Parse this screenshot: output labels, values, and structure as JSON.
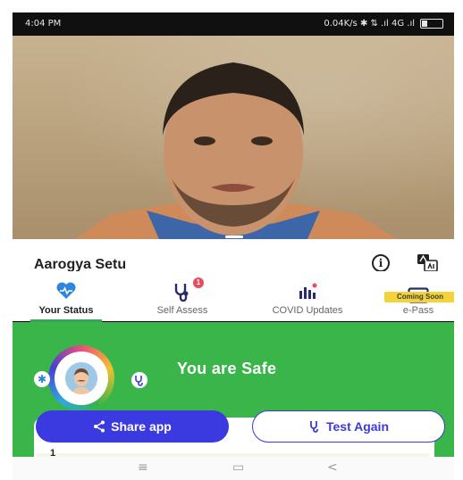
{
  "status_bar": {
    "time": "4:04 PM",
    "network": "0.04K/s ✱ ⇅ .ıl 4G .ıl"
  },
  "app": {
    "title": "Aarogya Setu"
  },
  "tabs": [
    {
      "label": "Your Status",
      "icon": "heart-icon"
    },
    {
      "label": "Self Assess",
      "icon": "stethoscope-icon",
      "badge": "1"
    },
    {
      "label": "COVID Updates",
      "icon": "chart-icon"
    },
    {
      "label": "e-Pass",
      "icon": "pass-icon",
      "tag": "Coming Soon"
    }
  ],
  "status": {
    "text": "You are Safe"
  },
  "buttons": {
    "share": "Share app",
    "test_again": "Test Again"
  },
  "list": {
    "first_index": "1"
  },
  "colors": {
    "safe_green": "#39b54a",
    "accent_blue": "#3b3ae0",
    "badge_red": "#e84c5a",
    "tag_yellow": "#f4d33a"
  }
}
